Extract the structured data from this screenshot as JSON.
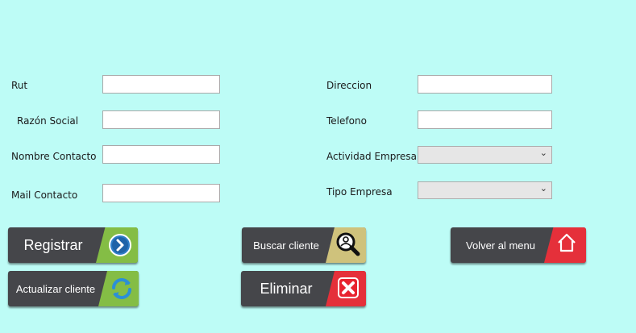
{
  "form": {
    "rut_label": "Rut",
    "razon_label": "Razón Social",
    "nombre_label": "Nombre Contacto",
    "mail_label": "Mail Contacto",
    "direccion_label": "Direccion",
    "telefono_label": "Telefono",
    "actividad_label": "Actividad Empresa",
    "tipo_label": "Tipo Empresa",
    "rut_value": "",
    "razon_value": "",
    "nombre_value": "",
    "mail_value": "",
    "direccion_value": "",
    "telefono_value": "",
    "actividad_selected": "",
    "tipo_selected": ""
  },
  "buttons": {
    "registrar": "Registrar",
    "actualizar": "Actualizar cliente",
    "buscar": "Buscar cliente",
    "eliminar": "Eliminar",
    "volver": "Volver al menu"
  },
  "icons": {
    "registrar": "arrow-right-icon",
    "actualizar": "refresh-icon",
    "buscar": "search-user-icon",
    "eliminar": "close-icon",
    "volver": "home-icon"
  },
  "colors": {
    "background": "#bdfcf6",
    "button_body": "#45464a",
    "accent_green": "#84bd45",
    "accent_khaki": "#cfc27c",
    "accent_red": "#e5303a"
  }
}
